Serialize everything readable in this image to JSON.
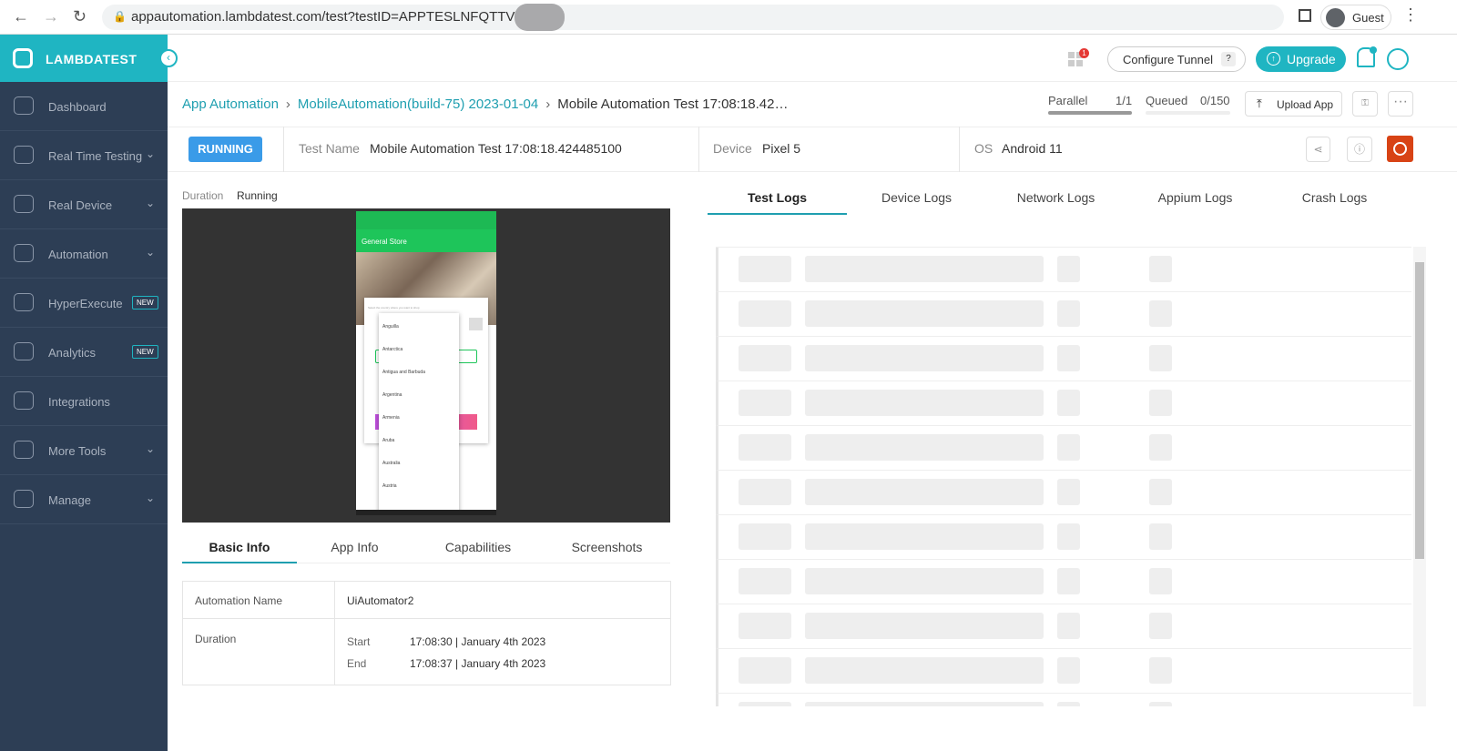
{
  "browser": {
    "url": "appautomation.lambdatest.com/test?testID=APPTESLNFQTTVSXW",
    "profile": "Guest"
  },
  "sidebar": {
    "brand": "LAMBDATEST",
    "items": [
      {
        "label": "Dashboard",
        "chevron": false
      },
      {
        "label": "Real Time Testing",
        "chevron": true
      },
      {
        "label": "Real Device",
        "chevron": true
      },
      {
        "label": "Automation",
        "chevron": true
      },
      {
        "label": "HyperExecute",
        "badge": "NEW"
      },
      {
        "label": "Analytics",
        "badge": "NEW"
      },
      {
        "label": "Integrations",
        "chevron": false
      },
      {
        "label": "More Tools",
        "chevron": true
      },
      {
        "label": "Manage",
        "chevron": true
      }
    ]
  },
  "topbar": {
    "notification_count": "1",
    "configure_tunnel": "Configure Tunnel",
    "help": "?",
    "upgrade": "Upgrade"
  },
  "breadcrumb": [
    "App Automation",
    "MobileAutomation(build-75) 2023-01-04",
    "Mobile Automation Test 17:08:18.42…"
  ],
  "concurrency": {
    "parallel_label": "Parallel",
    "parallel_value": "1/1",
    "parallel_fraction": 1,
    "queued_label": "Queued",
    "queued_value": "0/150",
    "queued_fraction": 0
  },
  "upload_app": "Upload App",
  "test": {
    "status": "RUNNING",
    "name_label": "Test Name",
    "name": "Mobile Automation Test 17:08:18.424485100",
    "device_label": "Device",
    "device": "Pixel 5",
    "os_label": "OS",
    "os": "Android 11",
    "duration_label": "Duration",
    "duration": "Running"
  },
  "phone": {
    "app_title": "General Store",
    "prompt": "Select the country where you want to shop",
    "countries": [
      "Anguilla",
      "Antarctica",
      "Antigua and Barbuda",
      "Argentina",
      "Armenia",
      "Aruba",
      "Australia",
      "Austria"
    ]
  },
  "info_tabs": [
    "Basic Info",
    "App Info",
    "Capabilities",
    "Screenshots"
  ],
  "basic_info": {
    "automation_label": "Automation Name",
    "automation": "UiAutomator2",
    "duration_label": "Duration",
    "start_label": "Start",
    "start": "17:08:30 | January 4th 2023",
    "end_label": "End",
    "end": "17:08:37 | January 4th 2023"
  },
  "log_tabs": [
    "Test Logs",
    "Device Logs",
    "Network Logs",
    "Appium Logs",
    "Crash Logs"
  ],
  "colors": {
    "brand": "#1fb5c2",
    "sidebar": "#2d3e55",
    "running": "#3a9be8",
    "stop": "#d84315"
  }
}
